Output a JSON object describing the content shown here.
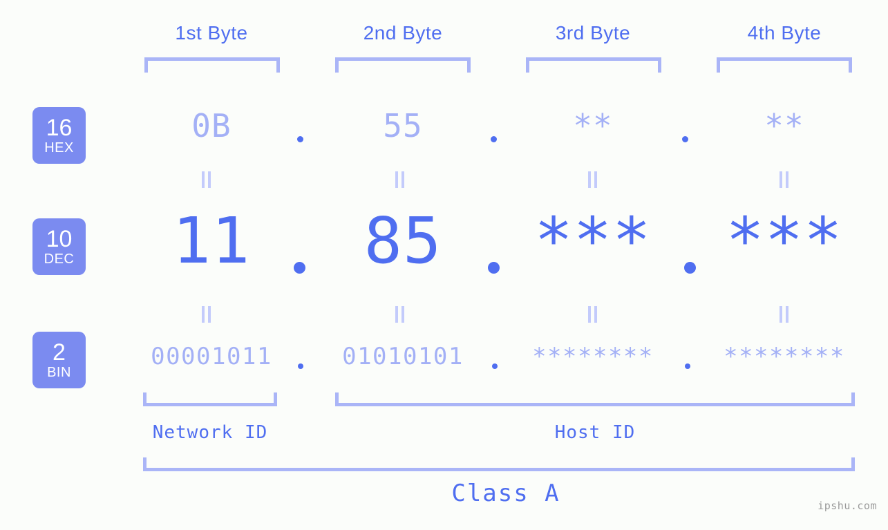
{
  "meta": {
    "background_color": "#fbfdfa",
    "accent_strong": "#4f6ef0",
    "accent_light": "#a3b0f6",
    "bracket_color": "#aab5f7",
    "badge_color": "#7b8bf0"
  },
  "header": {
    "bytes": [
      {
        "label": "1st Byte"
      },
      {
        "label": "2nd Byte"
      },
      {
        "label": "3rd Byte"
      },
      {
        "label": "4th Byte"
      }
    ]
  },
  "bases": [
    {
      "num": "16",
      "name": "HEX"
    },
    {
      "num": "10",
      "name": "DEC"
    },
    {
      "num": "2",
      "name": "BIN"
    }
  ],
  "rows": {
    "hex": {
      "values": [
        "0B",
        "55",
        "**",
        "**"
      ],
      "separator": "."
    },
    "dec": {
      "values": [
        "11",
        "85",
        "***",
        "***"
      ],
      "separator": "."
    },
    "bin": {
      "values": [
        "00001011",
        "01010101",
        "********",
        "********"
      ],
      "separator": "."
    }
  },
  "equals_marks": {
    "glyph": "||"
  },
  "sections": [
    {
      "label": "Network ID"
    },
    {
      "label": "Host ID"
    }
  ],
  "class": {
    "label": "Class A"
  },
  "watermark": {
    "text": "ipshu.com"
  }
}
